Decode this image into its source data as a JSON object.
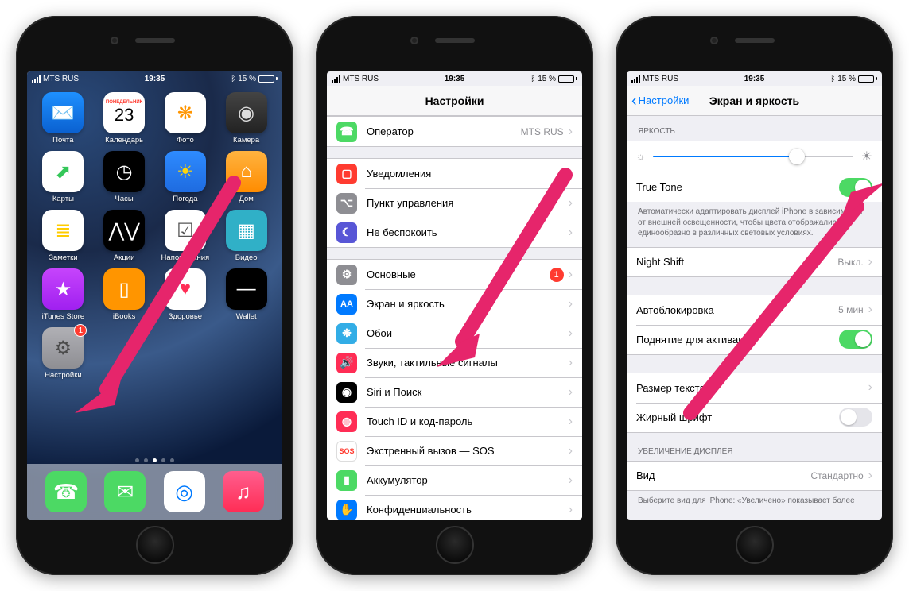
{
  "status": {
    "carrier": "MTS RUS",
    "time": "19:35",
    "battery_pct": "15 %",
    "bt_glyph": "฿"
  },
  "home": {
    "apps": [
      {
        "label": "Почта",
        "glyph": "✉️",
        "bg": "linear-gradient(#1e90ff,#0a60d0)"
      },
      {
        "label": "Календарь",
        "glyph": "23",
        "bg": "#fff",
        "text": "#ff3b30",
        "top": "ПОНЕДЕЛЬНИК"
      },
      {
        "label": "Фото",
        "glyph": "❋",
        "bg": "#fff",
        "text": "#ff9500"
      },
      {
        "label": "Камера",
        "glyph": "◉",
        "bg": "linear-gradient(#444,#222)",
        "text": "#ddd"
      },
      {
        "label": "Карты",
        "glyph": "⬈",
        "bg": "#fff",
        "text": "#34c759"
      },
      {
        "label": "Часы",
        "glyph": "◷",
        "bg": "#000",
        "text": "#fff"
      },
      {
        "label": "Погода",
        "glyph": "☀︎",
        "bg": "linear-gradient(#2e8bff,#1e6be0)",
        "text": "#ffd60a"
      },
      {
        "label": "Дом",
        "glyph": "⌂",
        "bg": "linear-gradient(#ffb340,#ff8c00)",
        "text": "#fff"
      },
      {
        "label": "Заметки",
        "glyph": "≣",
        "bg": "#fff",
        "text": "#ffcc00"
      },
      {
        "label": "Акции",
        "glyph": "⋀⋁",
        "bg": "#000",
        "text": "#fff"
      },
      {
        "label": "Напоминания",
        "glyph": "☑︎",
        "bg": "#fff",
        "text": "#555"
      },
      {
        "label": "Видео",
        "glyph": "▦",
        "bg": "#30b0c7",
        "text": "#fff"
      },
      {
        "label": "iTunes Store",
        "glyph": "★",
        "bg": "linear-gradient(#c644fc,#a020f0)",
        "text": "#fff"
      },
      {
        "label": "iBooks",
        "glyph": "▯",
        "bg": "#ff9500",
        "text": "#fff"
      },
      {
        "label": "Здоровье",
        "glyph": "♥︎",
        "bg": "#fff",
        "text": "#ff2d55"
      },
      {
        "label": "Wallet",
        "glyph": "—",
        "bg": "#000",
        "text": "#fff"
      },
      {
        "label": "Настройки",
        "glyph": "⚙︎",
        "bg": "linear-gradient(#b0b0b5,#8e8e93)",
        "text": "#4a4a4a",
        "badge": "1"
      }
    ],
    "dock": [
      {
        "name": "phone",
        "glyph": "☎︎",
        "bg": "#4cd964",
        "text": "#fff"
      },
      {
        "name": "messages",
        "glyph": "✉︎",
        "bg": "#4cd964",
        "text": "#fff"
      },
      {
        "name": "safari",
        "glyph": "◎",
        "bg": "#fff",
        "text": "#007aff"
      },
      {
        "name": "music",
        "glyph": "♫",
        "bg": "linear-gradient(#ff5e8e,#ff2d55)",
        "text": "#fff"
      }
    ]
  },
  "settings": {
    "title": "Настройки",
    "groups": [
      [
        {
          "icon": "phone",
          "bg": "bg-green",
          "label": "Оператор",
          "value": "MTS RUS"
        }
      ],
      [
        {
          "icon": "notif",
          "bg": "bg-red",
          "label": "Уведомления"
        },
        {
          "icon": "cc",
          "bg": "bg-grey",
          "label": "Пункт управления"
        },
        {
          "icon": "moon",
          "bg": "bg-purple",
          "label": "Не беспокоить"
        }
      ],
      [
        {
          "icon": "gear",
          "bg": "bg-grey",
          "label": "Основные",
          "badge": "1"
        },
        {
          "icon": "AA",
          "bg": "bg-blue",
          "label": "Экран и яркость"
        },
        {
          "icon": "flower",
          "bg": "bg-cyan",
          "label": "Обои"
        },
        {
          "icon": "sound",
          "bg": "bg-pink",
          "label": "Звуки, тактильные сигналы"
        },
        {
          "icon": "siri",
          "bg": "bg-black",
          "label": "Siri и Поиск"
        },
        {
          "icon": "touch",
          "bg": "bg-pink",
          "label": "Touch ID и код-пароль"
        },
        {
          "icon": "sos",
          "bg": "bg-white",
          "label": "Экстренный вызов — SOS"
        },
        {
          "icon": "batt",
          "bg": "bg-green",
          "label": "Аккумулятор"
        },
        {
          "icon": "hand",
          "bg": "bg-blue",
          "label": "Конфиденциальность"
        }
      ]
    ]
  },
  "brightness": {
    "back": "Настройки",
    "title": "Экран и яркость",
    "hdr_brightness": "ЯРКОСТЬ",
    "truetone": "True Tone",
    "truetone_desc": "Автоматически адаптировать дисплей iPhone в зависимости от внешней освещенности, чтобы цвета отображались единообразно в различных световых условиях.",
    "nightshift_label": "Night Shift",
    "nightshift_value": "Выкл.",
    "autolock_label": "Автоблокировка",
    "autolock_value": "5 мин",
    "raise_label": "Поднятие для активации",
    "textsize_label": "Размер текста",
    "bold_label": "Жирный шрифт",
    "hdr_zoom": "УВЕЛИЧЕНИЕ ДИСПЛЕЯ",
    "view_label": "Вид",
    "view_value": "Стандартно",
    "view_desc": "Выберите вид для iPhone: «Увеличено» показывает более"
  },
  "icon_glyphs": {
    "phone": "☎︎",
    "notif": "▢",
    "cc": "⌥",
    "moon": "☾",
    "gear": "⚙︎",
    "AA": "AA",
    "flower": "❋",
    "sound": "🔊",
    "siri": "◉",
    "touch": "◍",
    "sos": "SOS",
    "batt": "▮",
    "hand": "✋"
  }
}
